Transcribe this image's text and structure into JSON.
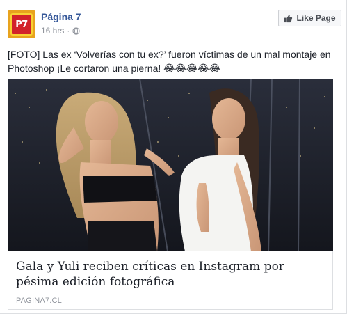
{
  "page": {
    "name": "Página 7",
    "avatar_text": "P7",
    "timestamp": "16 hrs",
    "separator": "·",
    "privacy_icon": "globe-icon"
  },
  "actions": {
    "like_page_label": "Like Page",
    "like_icon": "thumbs-up-icon"
  },
  "post": {
    "text": "[FOTO] Las ex ‘Volverías con tu ex?’ fueron víctimas de un mal montaje en Photoshop ¡Le cortaron una pierna! 😂😂😂😂😂"
  },
  "link": {
    "title": "Gala y Yuli reciben críticas en Instagram por pésima edición fotográfica",
    "domain": "PAGINA7.CL"
  },
  "colors": {
    "link_blue": "#365899",
    "meta_gray": "#90949c",
    "avatar_red": "#d2232a",
    "avatar_yellow": "#f7d233"
  }
}
